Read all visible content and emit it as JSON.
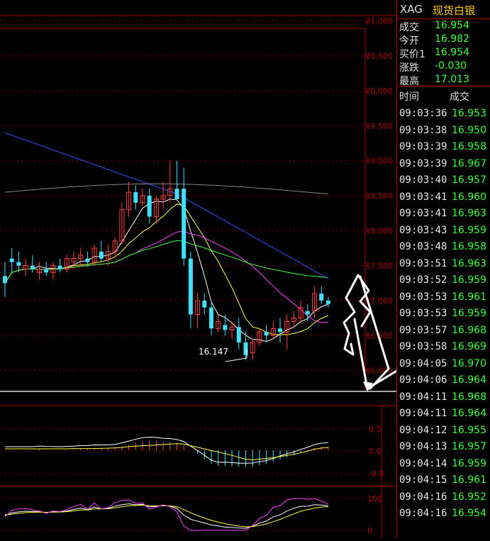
{
  "quote_panel": {
    "symbol": "XAG",
    "name": "现货白银",
    "fields": [
      {
        "label": "成交",
        "value": "16.954"
      },
      {
        "label": "今开",
        "value": "16.982"
      },
      {
        "label": "买价1",
        "value": "16.954"
      },
      {
        "label": "涨跌",
        "value": "-0.030"
      },
      {
        "label": "最高",
        "value": "17.013"
      }
    ],
    "ticks_header": {
      "time": "时间",
      "price": "成交"
    },
    "ticks": [
      {
        "time": "09:03:36",
        "price": "16.953"
      },
      {
        "time": "09:03:38",
        "price": "16.950"
      },
      {
        "time": "09:03:39",
        "price": "16.958"
      },
      {
        "time": "09:03:39",
        "price": "16.967"
      },
      {
        "time": "09:03:40",
        "price": "16.957"
      },
      {
        "time": "09:03:41",
        "price": "16.960"
      },
      {
        "time": "09:03:41",
        "price": "16.963"
      },
      {
        "time": "09:03:43",
        "price": "16.959"
      },
      {
        "time": "09:03:48",
        "price": "16.958"
      },
      {
        "time": "09:03:51",
        "price": "16.963"
      },
      {
        "time": "09:03:52",
        "price": "16.959"
      },
      {
        "time": "09:03:53",
        "price": "16.961"
      },
      {
        "time": "09:03:53",
        "price": "16.959"
      },
      {
        "time": "09:03:57",
        "price": "16.968"
      },
      {
        "time": "09:03:58",
        "price": "16.969"
      },
      {
        "time": "09:04:05",
        "price": "16.970"
      },
      {
        "time": "09:04:06",
        "price": "16.964"
      },
      {
        "time": "09:04:11",
        "price": "16.968"
      },
      {
        "time": "09:04:11",
        "price": "16.964"
      },
      {
        "time": "09:04:12",
        "price": "16.955"
      },
      {
        "time": "09:04:13",
        "price": "16.957"
      },
      {
        "time": "09:04:14",
        "price": "16.959"
      },
      {
        "time": "09:04:15",
        "price": "16.961"
      },
      {
        "time": "09:04:16",
        "price": "16.952"
      },
      {
        "time": "09:04:16",
        "price": "16.954"
      }
    ]
  },
  "chart_data": {
    "type": "candlestick",
    "price_axis": {
      "ticks": [
        "21.000",
        "20.500",
        "20.000",
        "19.500",
        "19.000",
        "18.500",
        "18.000",
        "17.500",
        "17.000",
        "16.500",
        "16.000"
      ],
      "range": [
        15.7,
        21.3
      ]
    },
    "low_marker": "16.147",
    "candles": [
      [
        17.35,
        17.55,
        17.05,
        17.25
      ],
      [
        17.6,
        17.75,
        17.4,
        17.55
      ],
      [
        17.55,
        17.7,
        17.4,
        17.5
      ],
      [
        17.45,
        17.6,
        17.35,
        17.5
      ],
      [
        17.5,
        17.65,
        17.4,
        17.45
      ],
      [
        17.4,
        17.55,
        17.3,
        17.45
      ],
      [
        17.45,
        17.55,
        17.35,
        17.4
      ],
      [
        17.4,
        17.55,
        17.3,
        17.5
      ],
      [
        17.5,
        17.6,
        17.4,
        17.45
      ],
      [
        17.45,
        17.65,
        17.4,
        17.6
      ],
      [
        17.55,
        17.7,
        17.45,
        17.6
      ],
      [
        17.6,
        17.75,
        17.5,
        17.65
      ],
      [
        17.6,
        17.7,
        17.5,
        17.55
      ],
      [
        17.55,
        17.8,
        17.5,
        17.75
      ],
      [
        17.7,
        17.85,
        17.55,
        17.6
      ],
      [
        17.6,
        17.8,
        17.5,
        17.7
      ],
      [
        17.7,
        17.9,
        17.6,
        17.85
      ],
      [
        17.85,
        18.4,
        17.8,
        18.3
      ],
      [
        18.3,
        18.7,
        18.2,
        18.55
      ],
      [
        18.55,
        18.65,
        18.3,
        18.4
      ],
      [
        18.4,
        18.6,
        18.35,
        18.5
      ],
      [
        18.5,
        18.6,
        18.1,
        18.2
      ],
      [
        18.2,
        18.5,
        18.1,
        18.45
      ],
      [
        18.45,
        18.7,
        18.3,
        18.5
      ],
      [
        18.5,
        19.0,
        18.4,
        18.6
      ],
      [
        18.6,
        19.0,
        18.5,
        18.45
      ],
      [
        18.6,
        18.9,
        17.5,
        17.6
      ],
      [
        17.6,
        17.7,
        16.6,
        16.8
      ],
      [
        16.8,
        17.1,
        16.6,
        17.0
      ],
      [
        17.0,
        17.1,
        16.8,
        16.9
      ],
      [
        16.9,
        17.0,
        16.5,
        16.6
      ],
      [
        16.6,
        16.8,
        16.55,
        16.7
      ],
      [
        16.65,
        16.8,
        16.5,
        16.58
      ],
      [
        16.58,
        16.7,
        16.45,
        16.62
      ],
      [
        16.62,
        16.75,
        16.3,
        16.4
      ],
      [
        16.4,
        16.55,
        16.15,
        16.22
      ],
      [
        16.25,
        16.45,
        16.15,
        16.4
      ],
      [
        16.4,
        16.6,
        16.35,
        16.55
      ],
      [
        16.55,
        16.65,
        16.4,
        16.5
      ],
      [
        16.5,
        16.7,
        16.45,
        16.6
      ],
      [
        16.6,
        16.75,
        16.4,
        16.55
      ],
      [
        16.55,
        16.8,
        16.3,
        16.7
      ],
      [
        16.7,
        16.85,
        16.6,
        16.75
      ],
      [
        16.75,
        17.0,
        16.7,
        16.9
      ],
      [
        16.85,
        16.95,
        16.7,
        16.8
      ],
      [
        16.85,
        17.2,
        16.75,
        17.1
      ],
      [
        17.1,
        17.2,
        16.95,
        17.0
      ],
      [
        17.0,
        17.05,
        16.9,
        16.95
      ]
    ]
  }
}
